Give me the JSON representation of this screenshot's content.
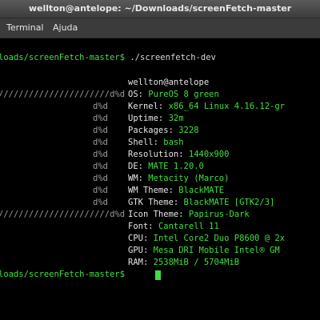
{
  "window": {
    "title": "wellton@antelope: ~/Downloads/screenFetch-master"
  },
  "menu": {
    "terminal": "Terminal",
    "help": "Ajuda"
  },
  "terminal": {
    "prompt1": "loads/screenFetch-master$",
    "command": "./screenfetch-dev",
    "userhost": "wellton@antelope",
    "logo": [
      "//////////////////////d%d",
      "d%d",
      "d%d",
      "d%d",
      "d%d",
      "d%d",
      "d%d",
      "d%d",
      "d%d",
      "d%d",
      "//////////////////////d%d"
    ],
    "info": [
      {
        "key": "OS:",
        "value": "PureOS 8 green"
      },
      {
        "key": "Kernel:",
        "value": "x86_64 Linux 4.16.12-gr"
      },
      {
        "key": "Uptime:",
        "value": "32m"
      },
      {
        "key": "Packages:",
        "value": "3228"
      },
      {
        "key": "Shell:",
        "value": "bash"
      },
      {
        "key": "Resolution:",
        "value": "1440x900"
      },
      {
        "key": "DE:",
        "value": "MATE 1.20.0"
      },
      {
        "key": "WM:",
        "value": "Metacity (Marco)"
      },
      {
        "key": "WM Theme:",
        "value": "BlackMATE"
      },
      {
        "key": "GTK Theme:",
        "value": "BlackMATE [GTK2/3]"
      },
      {
        "key": "Icon Theme:",
        "value": "Papirus-Dark"
      },
      {
        "key": "Font:",
        "value": "Cantarell 11"
      },
      {
        "key": "CPU:",
        "value": "Intel Core2 Duo P8600 @ 2x"
      },
      {
        "key": "GPU:",
        "value": "Mesa DRI Mobile Intel® GM"
      },
      {
        "key": "RAM:",
        "value": "2538MiB / 5704MiB"
      }
    ],
    "prompt2": "loads/screenFetch-master$"
  }
}
